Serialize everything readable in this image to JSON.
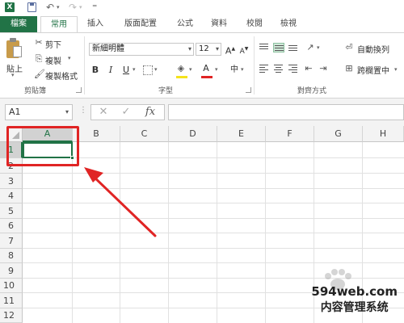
{
  "qat": {
    "logo": "X",
    "undo": "↶",
    "redo": "↷",
    "more": "⁼"
  },
  "tabs": [
    "檔案",
    "常用",
    "插入",
    "版面配置",
    "公式",
    "資料",
    "校閱",
    "檢視"
  ],
  "clipboard": {
    "paste": "貼上",
    "cut": "剪下",
    "copy": "複製",
    "format_painter": "複製格式",
    "group_label": "剪貼簿"
  },
  "font": {
    "name": "新細明體",
    "size": "12",
    "grow": "A",
    "shrink": "A",
    "bold": "B",
    "italic": "I",
    "underline": "U",
    "font_color": "A",
    "phonetic": "中",
    "group_label": "字型"
  },
  "alignment": {
    "wrap_text": "自動換列",
    "merge_center": "跨欄置中",
    "group_label": "對齊方式"
  },
  "formula_bar": {
    "name_box": "A1",
    "cancel": "✕",
    "enter": "✓",
    "fx": "fx",
    "value": ""
  },
  "grid": {
    "columns": [
      "A",
      "B",
      "C",
      "D",
      "E",
      "F",
      "G",
      "H"
    ],
    "rows": [
      "1",
      "2",
      "3",
      "4",
      "5",
      "6",
      "7",
      "8",
      "9",
      "10",
      "11",
      "12"
    ],
    "selected_cell": "A1"
  },
  "watermark": {
    "line1": "594web.com",
    "line2": "内容管理系统"
  },
  "colors": {
    "excel_green": "#217346",
    "annotation_red": "#e02424"
  }
}
